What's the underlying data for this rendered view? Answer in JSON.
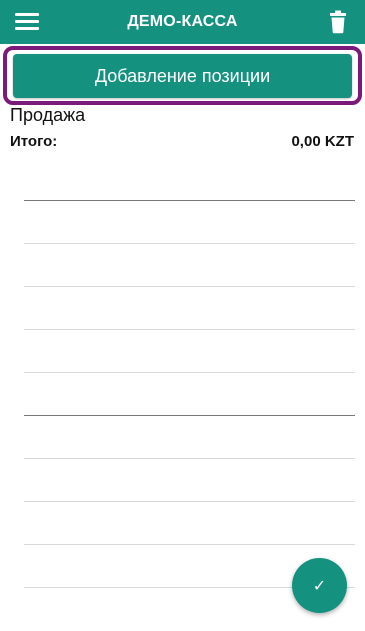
{
  "header": {
    "title": "ДЕМО-КАССА",
    "menu_icon": "hamburger-menu-icon",
    "delete_icon": "trash-icon"
  },
  "add_position": {
    "label": "Добавление позиции"
  },
  "sale": {
    "label": "Продажа",
    "total_label": "Итого:",
    "total_value": "0,00 KZT"
  },
  "fab": {
    "icon": "check-icon",
    "glyph": "✓"
  },
  "colors": {
    "primary": "#15917f",
    "highlight": "#7a1a7a"
  }
}
